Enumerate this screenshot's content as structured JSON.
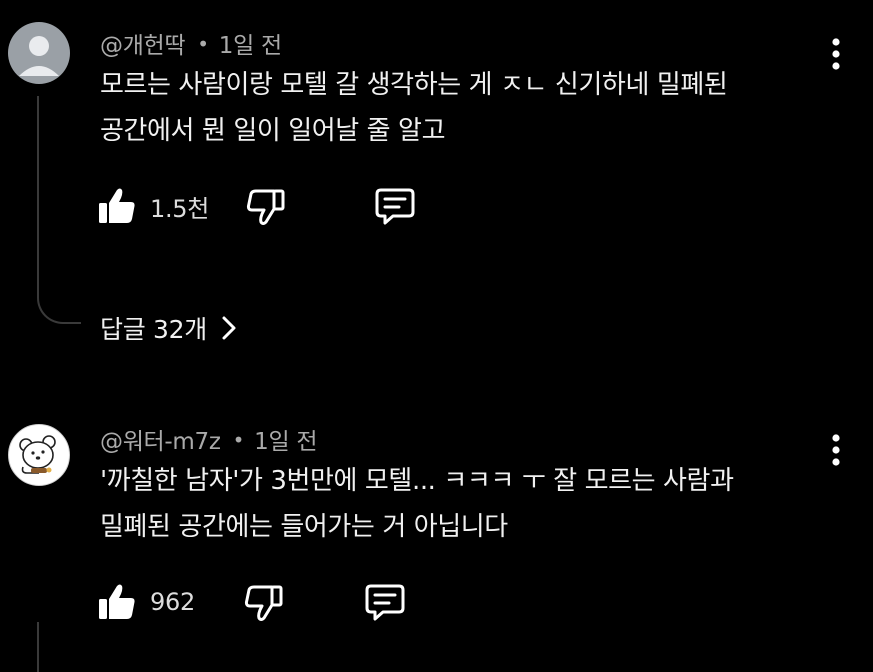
{
  "colors": {
    "background": "#000000",
    "text_primary": "#f1f1f1",
    "text_secondary": "#aaaaaa",
    "thread_line": "#3a3a3a",
    "icon": "#ffffff"
  },
  "comments": [
    {
      "author": "@개헌딱",
      "time": "1일 전",
      "separator": "•",
      "avatar_icon": "default-profile-icon",
      "lines": [
        "모르는 사람이랑 모텔 갈 생각하는 게 ㅈㄴ 신기하네 밀폐된",
        "공간에서 뭔 일이 일어날 줄 알고"
      ],
      "like_count": "1.5천",
      "replies_label": "답글 32개"
    },
    {
      "author": "@워터-m7z",
      "time": "1일 전",
      "separator": "•",
      "avatar_icon": "cartoon-bear-avatar-icon",
      "lines": [
        "'까칠한 남자'가 3번만에 모텔... ㅋㅋㅋ ㅜ 잘 모르는 사람과",
        "밀폐된 공간에는 들어가는 거 아닙니다"
      ],
      "like_count": "962"
    }
  ]
}
